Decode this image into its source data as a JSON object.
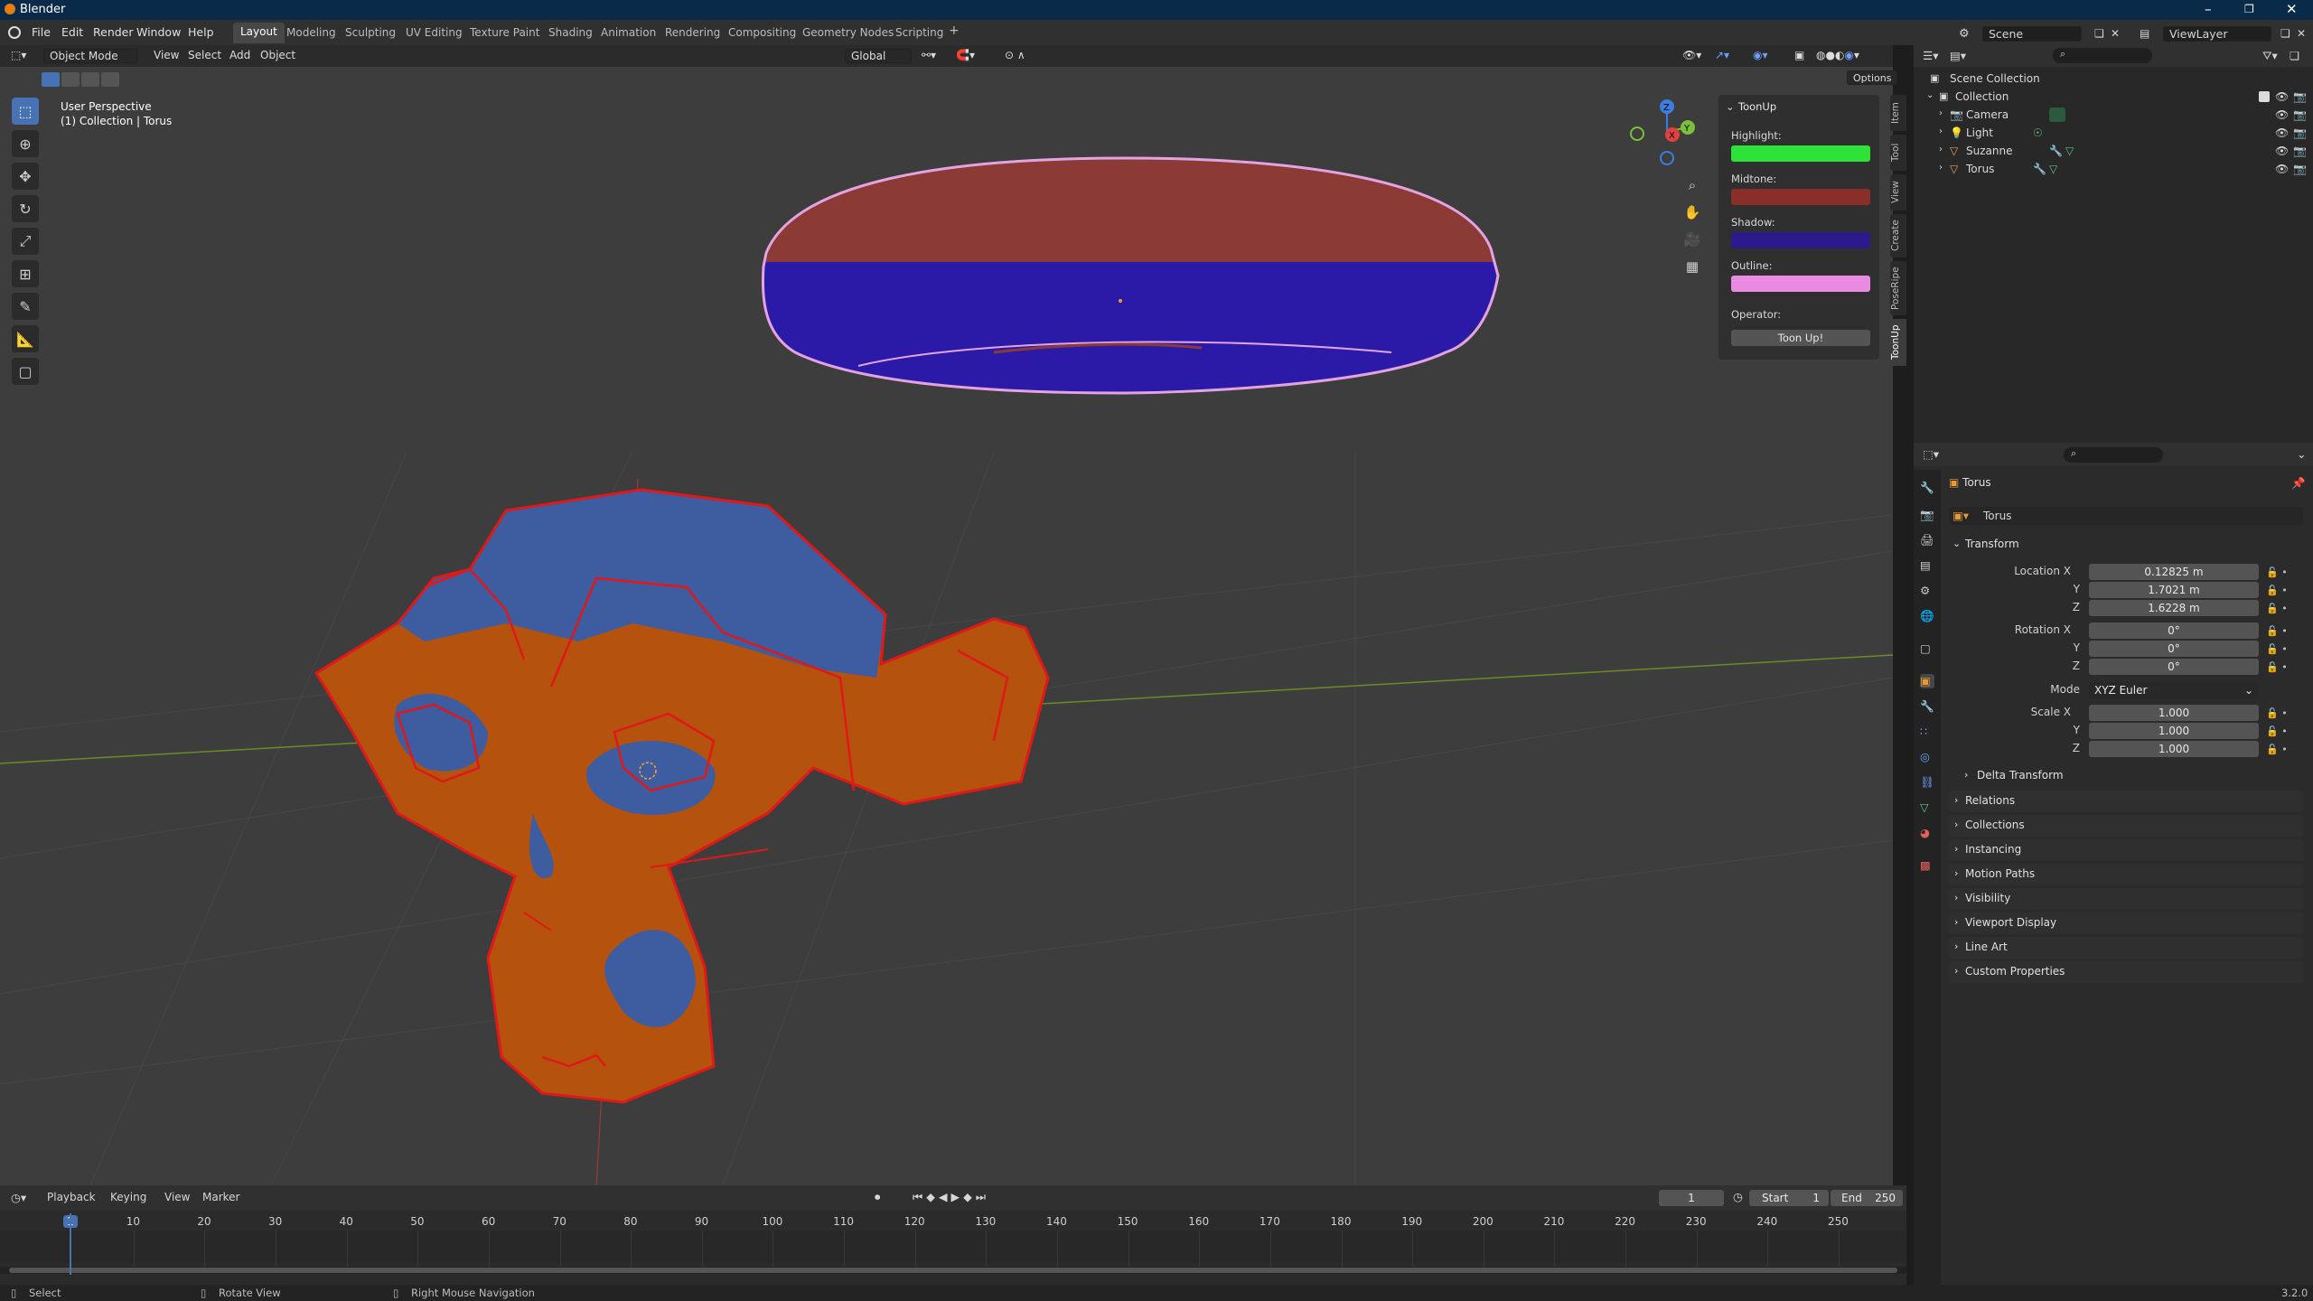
{
  "app": {
    "title": "Blender"
  },
  "menu": [
    "File",
    "Edit",
    "Render",
    "Window",
    "Help"
  ],
  "workspaces": [
    "Layout",
    "Modeling",
    "Sculpting",
    "UV Editing",
    "Texture Paint",
    "Shading",
    "Animation",
    "Rendering",
    "Compositing",
    "Geometry Nodes",
    "Scripting"
  ],
  "scene": {
    "name": "Scene",
    "viewlayer": "ViewLayer"
  },
  "viewport": {
    "mode": "Object Mode",
    "menus": [
      "View",
      "Select",
      "Add",
      "Object"
    ],
    "transform_orientation": "Global",
    "options_label": "Options",
    "info_title": "User Perspective",
    "info_sub": "(1) Collection | Torus",
    "axis_labels": [
      "Z",
      "X",
      "Y"
    ]
  },
  "npanel": {
    "title": "ToonUp",
    "highlight_label": "Highlight:",
    "midtone_label": "Midtone:",
    "shadow_label": "Shadow:",
    "outline_label": "Outline:",
    "operator_label": "Operator:",
    "button": "Toon Up!",
    "colors": {
      "highlight": "#2de33a",
      "midtone": "#8a2e2a",
      "shadow": "#2a1a8c",
      "outline": "#e98ae3"
    },
    "tabs": [
      "Item",
      "Tool",
      "View",
      "Create",
      "PoseRipe",
      "ToonUp"
    ]
  },
  "outliner": {
    "root": "Scene Collection",
    "collection": "Collection",
    "items": [
      "Camera",
      "Light",
      "Suzanne",
      "Torus"
    ]
  },
  "properties": {
    "object_name": "Torus",
    "data_name": "Torus",
    "transform_label": "Transform",
    "location": {
      "label": "Location X",
      "x": "0.12825 m",
      "y": "1.7021 m",
      "z": "1.6228 m"
    },
    "rotation": {
      "label": "Rotation X",
      "x": "0°",
      "y": "0°",
      "z": "0°"
    },
    "mode_label": "Mode",
    "mode_value": "XYZ Euler",
    "scale": {
      "label": "Scale X",
      "x": "1.000",
      "y": "1.000",
      "z": "1.000"
    },
    "axis_y": "Y",
    "axis_z": "Z",
    "delta": "Delta Transform",
    "sections": [
      "Relations",
      "Collections",
      "Instancing",
      "Motion Paths",
      "Visibility",
      "Viewport Display",
      "Line Art",
      "Custom Properties"
    ]
  },
  "timeline": {
    "menus": [
      "Playback",
      "Keying",
      "View",
      "Marker"
    ],
    "current_frame": "1",
    "start_label": "Start",
    "start": "1",
    "end_label": "End",
    "end": "250",
    "ticks": [
      "1",
      "10",
      "20",
      "30",
      "40",
      "50",
      "60",
      "70",
      "80",
      "90",
      "100",
      "110",
      "120",
      "130",
      "140",
      "150",
      "160",
      "170",
      "180",
      "190",
      "200",
      "210",
      "220",
      "230",
      "240",
      "250"
    ]
  },
  "status": {
    "select": "Select",
    "rotate": "Rotate View",
    "nav": "Right Mouse Navigation",
    "version": "3.2.0"
  }
}
